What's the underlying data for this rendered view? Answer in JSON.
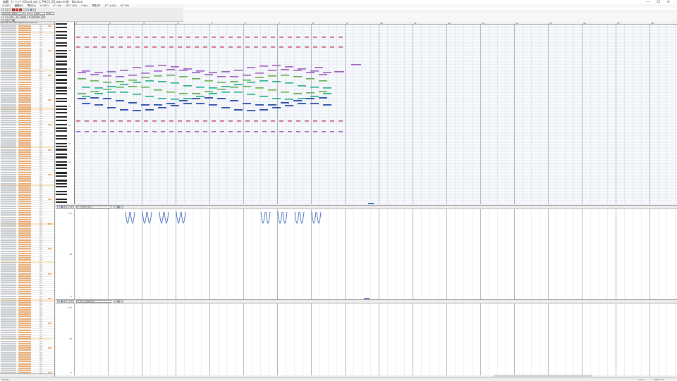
{
  "window": {
    "title": "無題 - [ﾃﾞﾓｿﾝｸﾞ(Chord_set_C_PHC)]_E5.wav.mid] - Domino",
    "controls": [
      "—",
      "☐",
      "✕"
    ]
  },
  "menu": [
    "ﾌｧｲﾙ(F)",
    "編集(E)",
    "表示(V)",
    "ﾄﾗｯｸ(T)",
    "ｲﾍﾞﾝﾄ(I)",
    "ｽｸﾘﾌﾟﾄ(S)",
    "ﾂｰﾙ(L)",
    "再生(P)",
    "ｵﾌﾟｼｮﾝ(O)",
    "ﾍﾙﾌﾟ(H)"
  ],
  "toolbar": {
    "track_label": "1ﾄﾗｯｸ 1: Piano",
    "position": "001 : 01 : 0000",
    "tempo": "120.00",
    "beat": "4/4",
    "snap": "1/4",
    "zoom": "100"
  },
  "eventlist": {
    "headers": [
      "Meas",
      "Bt",
      "Tick",
      "Gate",
      "Step",
      "Event",
      "Gate",
      "Vel",
      "Octave"
    ]
  },
  "pianoroll": {
    "measures": [
      "1",
      "2",
      "3",
      "4",
      "5",
      "6",
      "7",
      "8",
      "9",
      "10",
      "11",
      "12",
      "13",
      "14",
      "15",
      "16",
      "17",
      "18"
    ],
    "octaves": [
      "C5",
      "C4",
      "C3",
      "C2",
      "C1",
      "C0",
      "C-1"
    ]
  },
  "ctrl1": {
    "select": "ﾀﾞｲﾅﾐｸｽ/ﾍﾞﾛｼﾃｨ",
    "axis": [
      "127",
      "64",
      "0"
    ]
  },
  "ctrl2": {
    "select": "ﾍﾞﾛｼﾃｨ (Velocity)",
    "axis": [
      "127",
      "64",
      "0"
    ]
  },
  "statusbar": {
    "left": "Ready",
    "right1": "1:1:0",
    "right2": "OFF  Ch:1"
  },
  "colors": {
    "pink": "#e8869c",
    "violet": "#c98be6",
    "green": "#8fd87a",
    "teal": "#4fd6b8",
    "blue": "#4466cc"
  }
}
